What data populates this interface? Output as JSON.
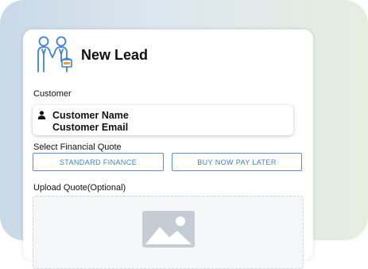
{
  "header": {
    "title": "New Lead",
    "logo_icon": "two-people-handshake-icon"
  },
  "customer": {
    "section_label": "Customer",
    "icon": "user-icon",
    "name": "Customer Name",
    "email": "Customer Email"
  },
  "financial_quote": {
    "section_label": "Select Financial Quote",
    "options": [
      "STANDARD FINANCE",
      "BUY NOW PAY LATER"
    ]
  },
  "upload": {
    "section_label": "Upload Quote(Optional)",
    "placeholder_icon": "image-placeholder-icon"
  },
  "colors": {
    "accent": "#3f7fd6",
    "button_border": "#5a8fd8",
    "logo_blue": "#3f7fd6",
    "logo_orange": "#f0a030",
    "upload_bg": "#f4f6f8"
  }
}
